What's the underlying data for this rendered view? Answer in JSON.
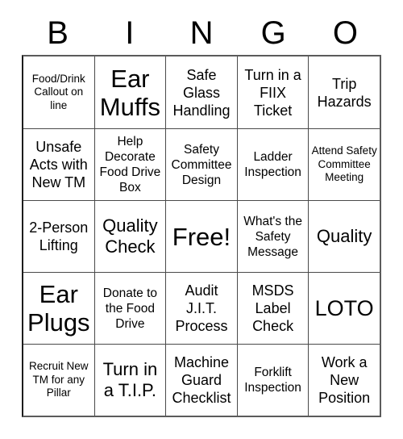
{
  "card": {
    "header_letters": [
      "B",
      "I",
      "N",
      "G",
      "O"
    ],
    "rows": [
      [
        {
          "text": "Food/Drink Callout on line",
          "size": "xs"
        },
        {
          "text": "Ear Muffs",
          "size": "xxl"
        },
        {
          "text": "Safe Glass Handling",
          "size": "m"
        },
        {
          "text": "Turn in a FIIX Ticket",
          "size": "m"
        },
        {
          "text": "Trip Hazards",
          "size": "m"
        }
      ],
      [
        {
          "text": "Unsafe Acts with New TM",
          "size": "m"
        },
        {
          "text": "Help Decorate Food Drive Box",
          "size": "s"
        },
        {
          "text": "Safety Committee Design",
          "size": "s"
        },
        {
          "text": "Ladder Inspection",
          "size": "s"
        },
        {
          "text": "Attend Safety Committee Meeting",
          "size": "xs"
        }
      ],
      [
        {
          "text": "2-Person Lifting",
          "size": "m"
        },
        {
          "text": "Quality Check",
          "size": "l"
        },
        {
          "text": "Free!",
          "size": "xxl"
        },
        {
          "text": "What's the Safety Message",
          "size": "s"
        },
        {
          "text": "Quality",
          "size": "l"
        }
      ],
      [
        {
          "text": "Ear Plugs",
          "size": "xxl"
        },
        {
          "text": "Donate to the Food Drive",
          "size": "s"
        },
        {
          "text": "Audit J.I.T. Process",
          "size": "m"
        },
        {
          "text": "MSDS Label Check",
          "size": "m"
        },
        {
          "text": "LOTO",
          "size": "xl"
        }
      ],
      [
        {
          "text": "Recruit New TM for any Pillar",
          "size": "xs"
        },
        {
          "text": "Turn in a T.I.P.",
          "size": "l"
        },
        {
          "text": "Machine Guard Checklist",
          "size": "m"
        },
        {
          "text": "Forklift Inspection",
          "size": "s"
        },
        {
          "text": "Work a New Position",
          "size": "m"
        }
      ]
    ]
  }
}
